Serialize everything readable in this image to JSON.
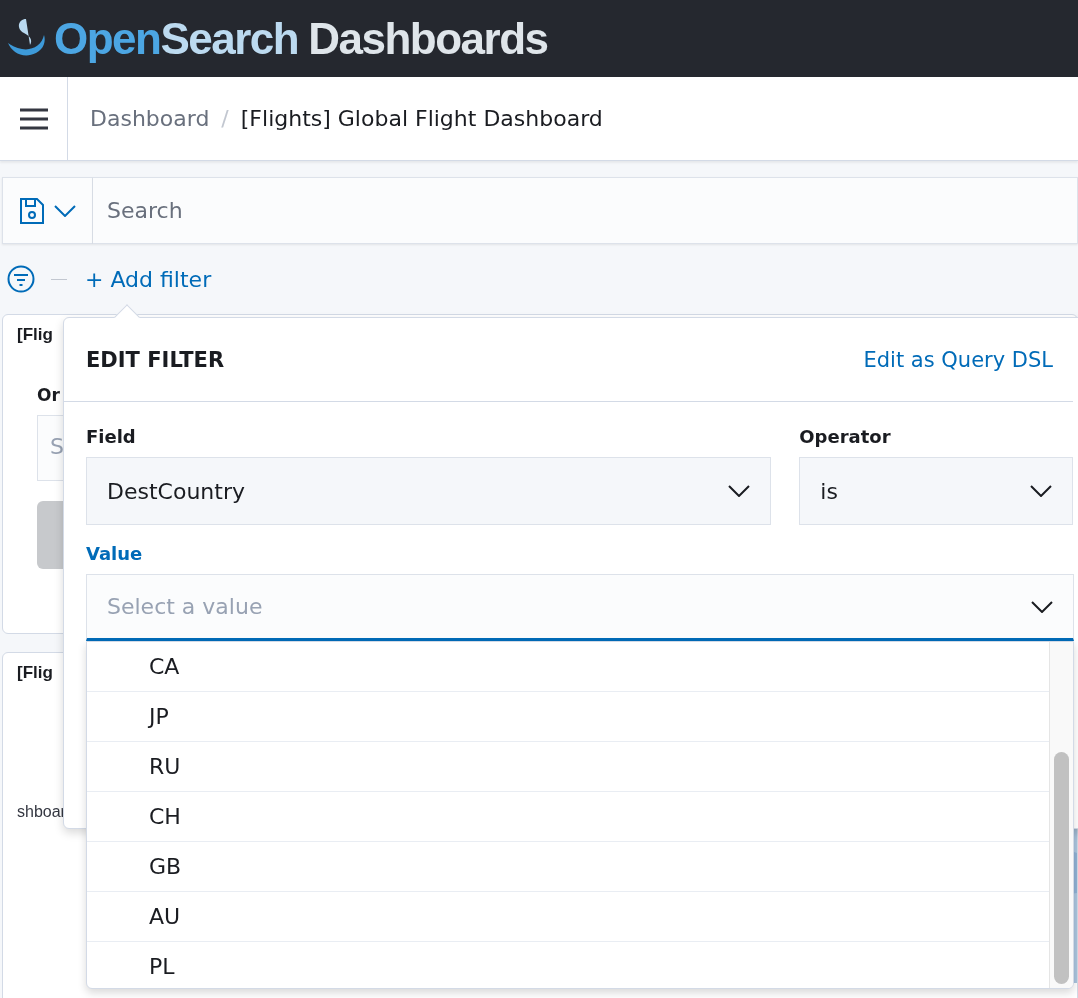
{
  "header": {
    "logo_word_1": "Open",
    "logo_word_2": "Search",
    "logo_word_3": "Dashboards"
  },
  "breadcrumb_separator": "/",
  "breadcrumbs": [
    {
      "label": "Dashboard",
      "current": false
    },
    {
      "label": "[Flights] Global Flight Dashboard",
      "current": true
    }
  ],
  "query_bar": {
    "placeholder": "Search"
  },
  "filter_bar": {
    "add_filter": "+ Add filter"
  },
  "background_panels": [
    {
      "title": "[Flig",
      "control_label": "Or",
      "control_placeholder": "S"
    },
    {
      "title": "[Flig",
      "text": "shboar"
    }
  ],
  "edit_filter": {
    "title": "EDIT FILTER",
    "link": "Edit as Query DSL",
    "field": {
      "label": "Field",
      "value": "DestCountry"
    },
    "operator": {
      "label": "Operator",
      "value": "is"
    },
    "value": {
      "label": "Value",
      "placeholder": "Select a value",
      "options": [
        "CA",
        "JP",
        "RU",
        "CH",
        "GB",
        "AU",
        "PL"
      ]
    }
  }
}
